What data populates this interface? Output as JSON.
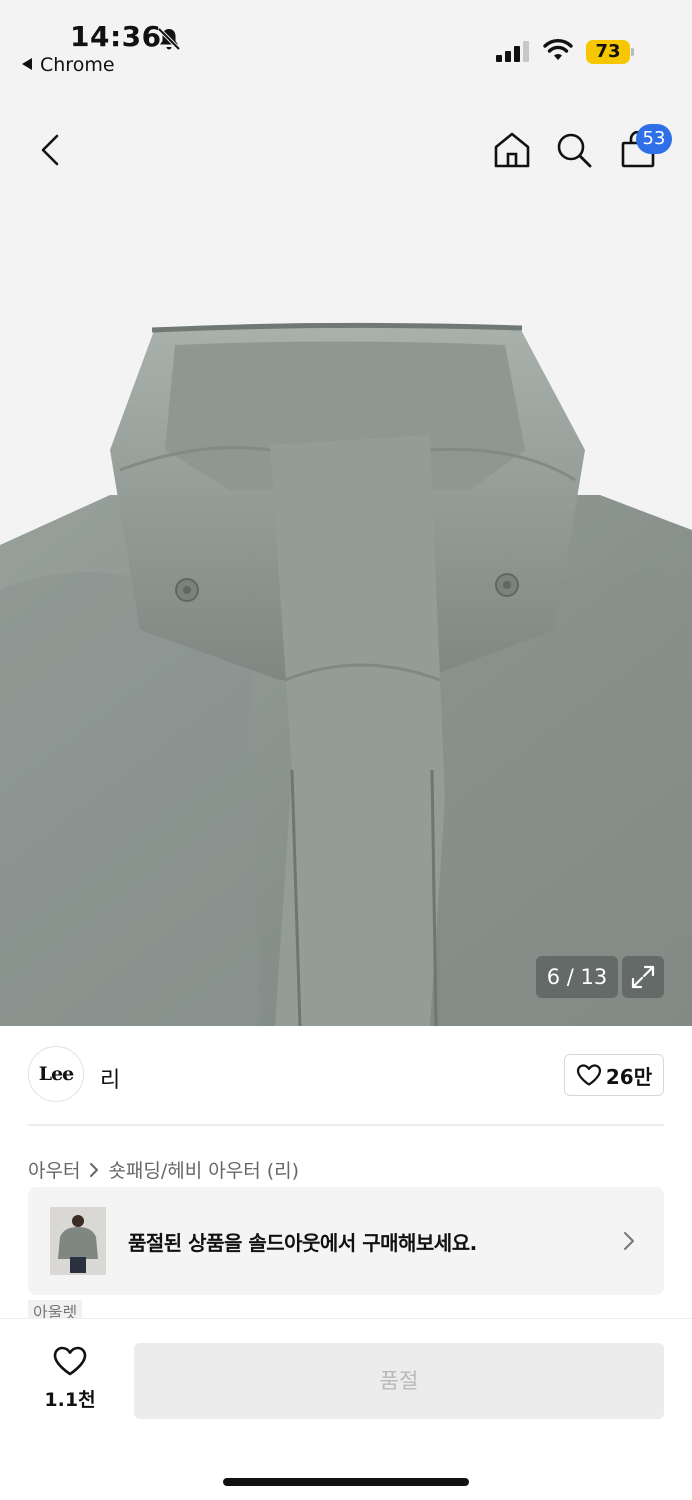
{
  "status_bar": {
    "time": "14:36",
    "back_app": "Chrome",
    "battery": "73",
    "battery_color": "#f6c700"
  },
  "nav": {
    "back_icon": "chevron-left-icon",
    "home_icon": "home-icon",
    "search_icon": "search-icon",
    "cart_icon": "shopping-bag-icon",
    "cart_badge": "53",
    "badge_color": "#2f6fe8"
  },
  "gallery": {
    "current": 6,
    "total": 13,
    "counter": "6 / 13",
    "expand_icon": "expand-icon"
  },
  "brand": {
    "logo_text": "Lee",
    "name": "리",
    "likes": "26만"
  },
  "breadcrumb": {
    "category": "아우터",
    "subcategory": "숏패딩/헤비 아우터 (리)"
  },
  "soldout_card": {
    "message": "품절된 상품을 솔드아웃에서 구매해보세요."
  },
  "tag": "아울렛",
  "bottom": {
    "wish_count": "1.1천",
    "buy_label": "품절"
  }
}
